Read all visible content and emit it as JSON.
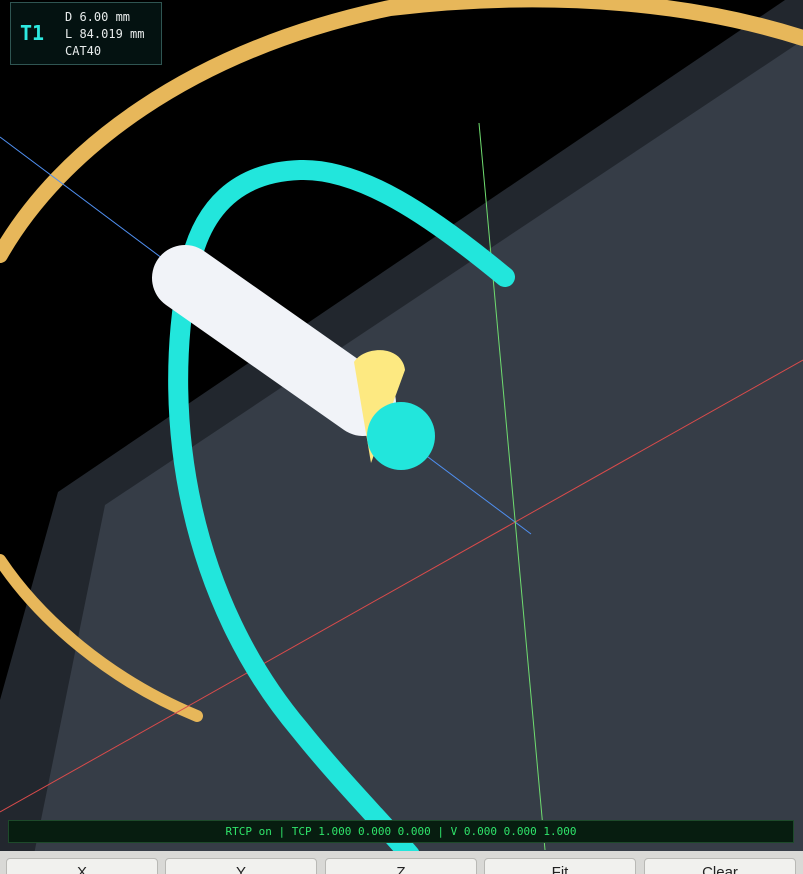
{
  "tool": {
    "id": "T1",
    "diameter": "D 6.00 mm",
    "length": "L 84.019 mm",
    "holder": "CAT40"
  },
  "status": {
    "text": "RTCP on | TCP 1.000 0.000 0.000 | V 0.000 0.000 1.000"
  },
  "toolbar": {
    "x_label": "X",
    "y_label": "Y",
    "z_label": "Z",
    "fit_label": "Fit",
    "clear_label": "Clear"
  },
  "colors": {
    "background": "#000000",
    "plane_face": "#363d47",
    "plane_edge": "#22272e",
    "orbit_path": "#e7b75a",
    "toolpath": "#22e6dc",
    "tool_body": "#f1f3f8",
    "tool_tip": "#fde981",
    "axis_x": "#d94b4b",
    "axis_y": "#6fdc6f",
    "axis_z": "#4f8ff0"
  }
}
